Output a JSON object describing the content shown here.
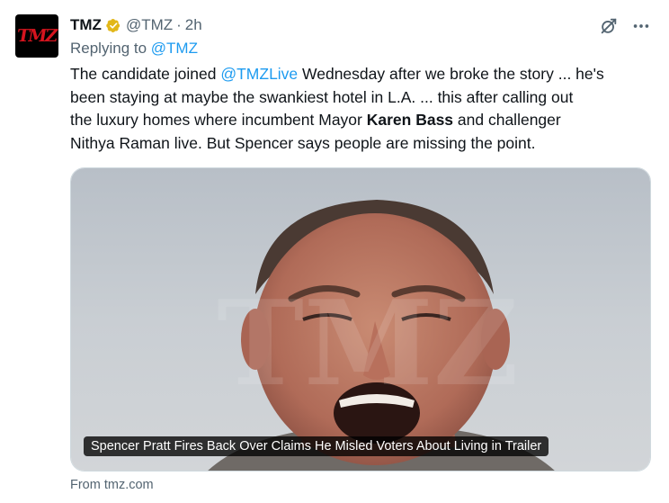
{
  "author": {
    "avatar_text": "TMZ",
    "name": "TMZ",
    "handle": "@TMZ",
    "separator": "·",
    "time": "2h"
  },
  "reply": {
    "prefix": "Replying to ",
    "mention": "@TMZ"
  },
  "body": {
    "line1_a": "The candidate joined ",
    "line1_mention": "@TMZLive",
    "line1_b": " Wednesday after we broke the story ... he's",
    "line2": "been staying at maybe the swankiest hotel in L.A. ... this after calling out",
    "line3_a": "the luxury homes where incumbent Mayor ",
    "line3_bold": "Karen Bass",
    "line3_b": " and challenger",
    "line4": "Nithya Raman live. But Spencer says people are missing the point."
  },
  "card": {
    "title": "Spencer Pratt Fires Back Over Claims He Misled Voters About Living in Trailer",
    "watermark": "TMZ",
    "source": "From tmz.com"
  },
  "icons": {
    "verified": "verified-gold-badge-icon",
    "grok": "grok-icon",
    "more": "more-options-icon"
  },
  "colors": {
    "link": "#1d9bf0",
    "muted": "#536471",
    "verified_gold": "#e2b719"
  }
}
